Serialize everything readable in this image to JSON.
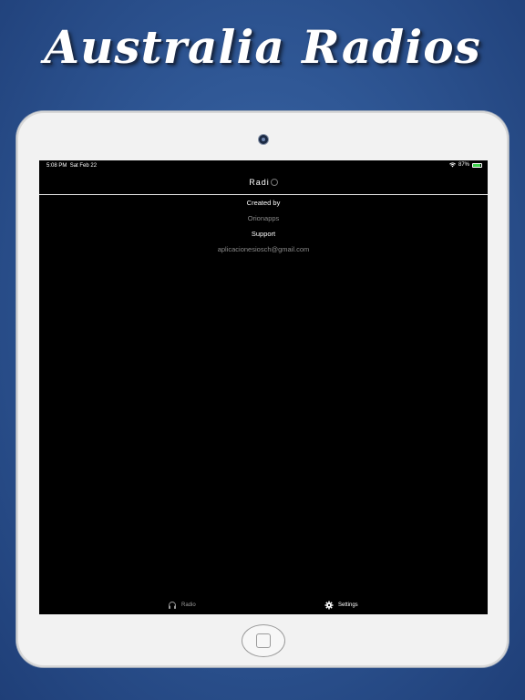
{
  "headline": "Australia Radios",
  "status_bar": {
    "time": "5:08 PM",
    "date": "Sat Feb 22",
    "battery": "87%",
    "battery_level": 0.87
  },
  "nav": {
    "title": "Radi"
  },
  "settings": {
    "created_by_label": "Created by",
    "created_by_value": "Orionapps",
    "support_label": "Support",
    "support_value": "aplicacionesiosch@gmail.com"
  },
  "tabs": [
    {
      "label": "Radio",
      "icon": "headphones-icon"
    },
    {
      "label": "Settings",
      "icon": "gear-icon"
    }
  ],
  "colors": {
    "background": "#2f5795",
    "screen": "#000000",
    "battery": "#3bd14a"
  }
}
